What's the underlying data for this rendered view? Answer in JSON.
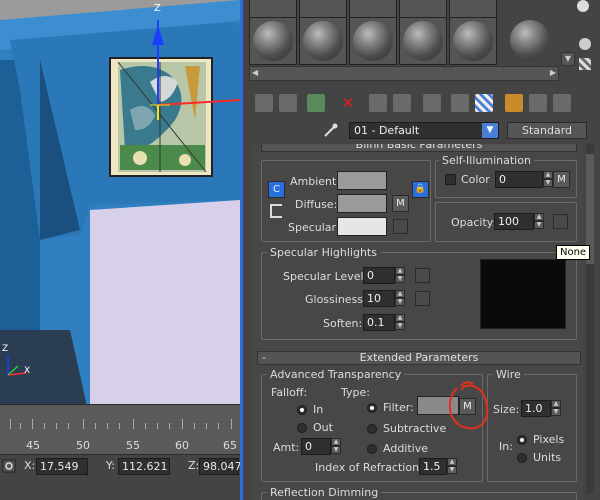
{
  "viewport": {
    "axis_top": "Z",
    "axis_corner_z": "Z",
    "axis_corner_x": "X"
  },
  "timeline": {
    "labels": [
      "45",
      "50",
      "55",
      "60",
      "65"
    ]
  },
  "status": {
    "x_label": "X:",
    "x_value": "17.549",
    "y_label": "Y:",
    "y_value": "112.621",
    "z_label": "Z:",
    "z_value": "98.047"
  },
  "material_editor": {
    "material_name": "01 - Default",
    "material_type": "Standard",
    "combo_arrow": "▼",
    "blinn": {
      "title": "Blinn Basic Parameters",
      "ambient_label": "Ambient:",
      "diffuse_label": "Diffuse:",
      "specular_label": "Specular:",
      "lock_c_label": "C",
      "diffuse_map_btn": "M",
      "self_illum_title": "Self-Illumination",
      "color_label": "Color",
      "color_value": "0",
      "self_illum_map_btn": "M",
      "opacity_label": "Opacity:",
      "opacity_value": "100"
    },
    "specular": {
      "title": "Specular Highlights",
      "level_label": "Specular Level:",
      "level_value": "0",
      "gloss_label": "Glossiness:",
      "gloss_value": "10",
      "soften_label": "Soften:",
      "soften_value": "0.1"
    },
    "extended": {
      "collapse": "-",
      "title": "Extended Parameters",
      "adv_title": "Advanced Transparency",
      "falloff_label": "Falloff:",
      "type_label": "Type:",
      "in_label": "In",
      "out_label": "Out",
      "filter_label": "Filter:",
      "filter_map_btn": "M",
      "subtractive_label": "Subtractive",
      "additive_label": "Additive",
      "amt_label": "Amt:",
      "amt_value": "0",
      "ior_label": "Index of Refraction:",
      "ior_value": "1.5",
      "wire_title": "Wire",
      "size_label": "Size:",
      "size_value": "1.0",
      "in2_label": "In:",
      "pixels_label": "Pixels",
      "units_label": "Units",
      "reflection_title": "Reflection Dimming"
    },
    "tooltip": "None"
  },
  "colors": {
    "viewport_blue": "#2f7fc1",
    "accent_blue": "#2a6fe0",
    "annotation_red": "#e0301e",
    "wall_lavender": "#d8cfe8"
  }
}
